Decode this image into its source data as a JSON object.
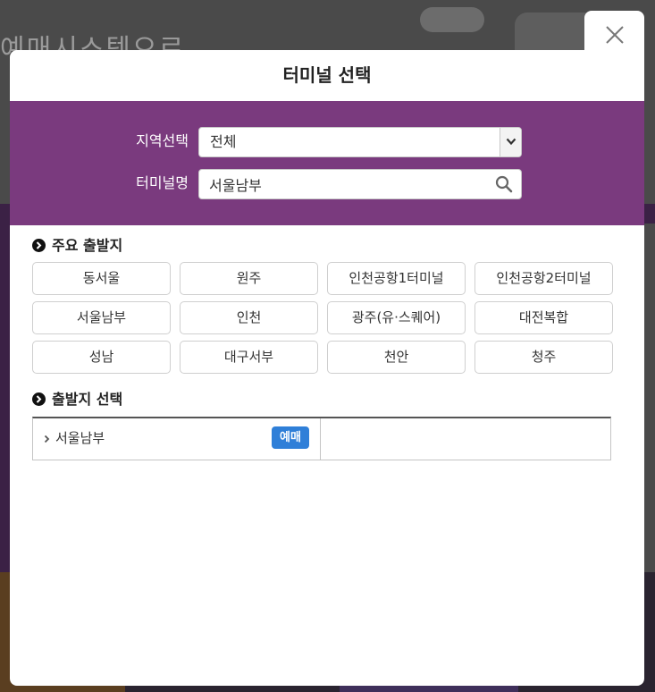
{
  "background": {
    "title": "예매시스템으로"
  },
  "modal": {
    "title": "터미널 선택",
    "close_label": "close"
  },
  "search": {
    "region_label": "지역선택",
    "region_value": "전체",
    "terminal_label": "터미널명",
    "terminal_value": "서울남부"
  },
  "major_departures": {
    "heading": "주요 출발지",
    "items": [
      "동서울",
      "원주",
      "인천공항1터미널",
      "인천공항2터미널",
      "서울남부",
      "인천",
      "광주(유·스퀘어)",
      "대전복합",
      "성남",
      "대구서부",
      "천안",
      "청주"
    ]
  },
  "departure_select": {
    "heading": "출발지 선택",
    "items": [
      {
        "name": "서울남부",
        "badge": "예매"
      }
    ]
  },
  "colors": {
    "panel": "#7a3a7e",
    "badge": "#2f7fd8"
  }
}
